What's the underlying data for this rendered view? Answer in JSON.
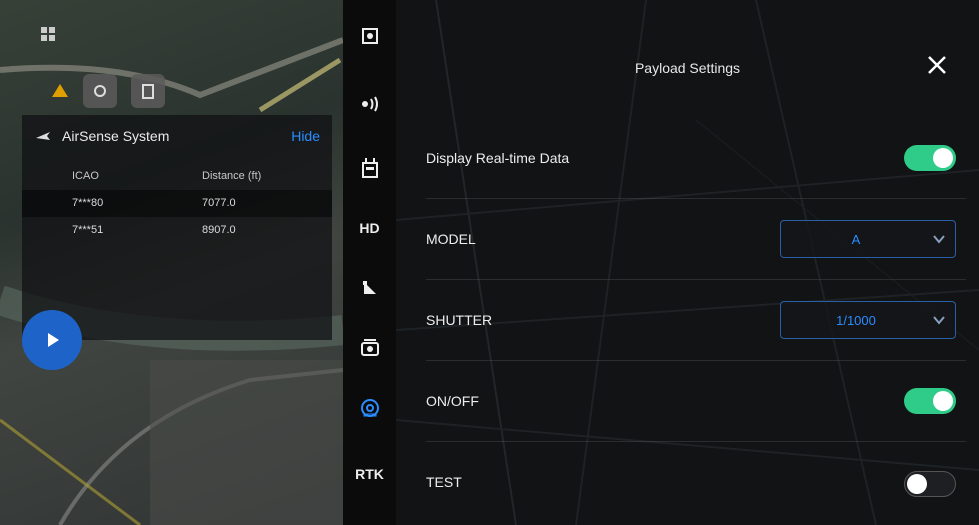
{
  "map": {
    "top_icon": "grid-icon",
    "buttons": [
      "settings-icon",
      "battery-icon"
    ],
    "warning_text": ""
  },
  "airsense": {
    "title": "AirSense System",
    "hide_label": "Hide",
    "columns": [
      "ICAO",
      "Distance (ft)"
    ],
    "rows": [
      {
        "icao": "7***80",
        "distance": "7077.0"
      },
      {
        "icao": "7***51",
        "distance": "8907.0"
      }
    ]
  },
  "toolbar": {
    "items": [
      {
        "name": "aircraft-status-icon"
      },
      {
        "name": "signal-icon"
      },
      {
        "name": "remote-controller-icon"
      },
      {
        "label": "HD"
      },
      {
        "name": "gimbal-icon"
      },
      {
        "name": "camera-icon"
      },
      {
        "name": "payload-icon"
      },
      {
        "label": "RTK"
      }
    ]
  },
  "panel": {
    "title": "Payload Settings",
    "rows": [
      {
        "label": "Display Real-time Data",
        "type": "toggle",
        "state": "on"
      },
      {
        "label": "MODEL",
        "type": "select",
        "value": "A"
      },
      {
        "label": "SHUTTER",
        "type": "select",
        "value": "1/1000"
      },
      {
        "label": "ON/OFF",
        "type": "toggle",
        "state": "on"
      },
      {
        "label": "TEST",
        "type": "toggle",
        "state": "off"
      }
    ]
  },
  "colors": {
    "accent": "#2a8cff",
    "toggle_on": "#2ecc88",
    "hide_link": "#2a8cff"
  }
}
